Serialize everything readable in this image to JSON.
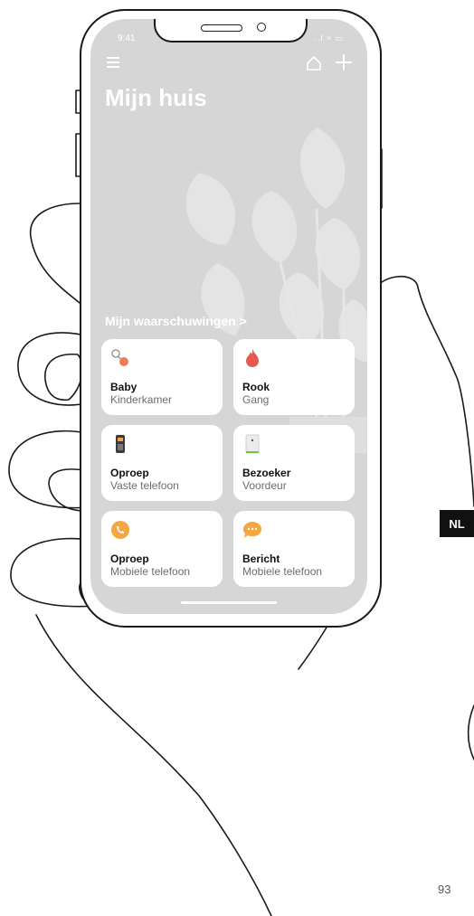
{
  "status": {
    "time": "9:41",
    "icons": "..l ≈ ▭"
  },
  "header": {
    "title": "Mijn huis"
  },
  "section": {
    "title": "Mijn waarschuwingen >"
  },
  "cards": [
    {
      "title": "Baby",
      "subtitle": "Kinderkamer",
      "icon": "baby-rattle-icon"
    },
    {
      "title": "Rook",
      "subtitle": "Gang",
      "icon": "flame-icon"
    },
    {
      "title": "Oproep",
      "subtitle": "Vaste telefoon",
      "icon": "desk-phone-icon"
    },
    {
      "title": "Bezoeker",
      "subtitle": "Voordeur",
      "icon": "door-intercom-icon"
    },
    {
      "title": "Oproep",
      "subtitle": "Mobiele telefoon",
      "icon": "phone-call-icon"
    },
    {
      "title": "Bericht",
      "subtitle": "Mobiele telefoon",
      "icon": "message-bubble-icon"
    }
  ],
  "page": {
    "language": "NL",
    "number": "93"
  },
  "colors": {
    "screen_background": "#d6d6d6",
    "flame": "#e8584f",
    "call_orange": "#f4a640",
    "door_green": "#7ac142"
  }
}
